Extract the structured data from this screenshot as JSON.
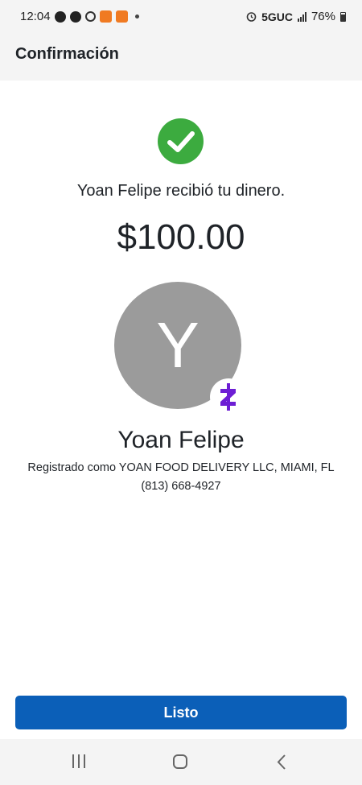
{
  "status_bar": {
    "time": "12:04",
    "network": "5GUC",
    "battery": "76%"
  },
  "header": {
    "title": "Confirmación"
  },
  "confirmation": {
    "message": "Yoan Felipe recibió tu dinero.",
    "amount": "$100.00",
    "avatar_initial": "Y",
    "recipient_name": "Yoan Felipe",
    "registered_as": "Registrado como YOAN FOOD DELIVERY LLC, MIAMI, FL",
    "phone": "(813) 668-4927",
    "check_color": "#3cab3f",
    "zelle_color": "#6d1ed4"
  },
  "actions": {
    "done_label": "Listo"
  },
  "icons": {
    "success": "checkmark-circle-icon",
    "payment_brand": "zelle-icon",
    "nav_recents": "recents-icon",
    "nav_home": "home-icon",
    "nav_back": "back-icon"
  },
  "colors": {
    "primary_button": "#0b5fb8",
    "header_bg": "#f4f4f4"
  }
}
